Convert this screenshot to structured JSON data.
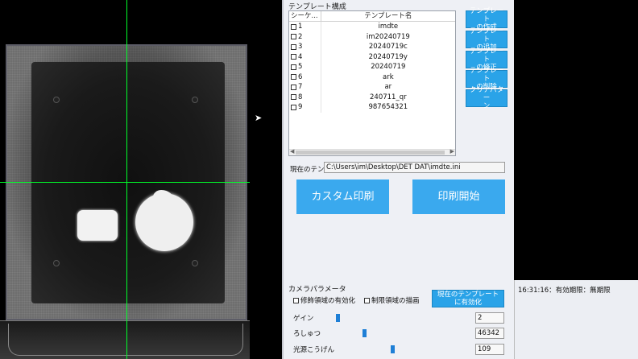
{
  "template_group": {
    "title": "テンプレート構成",
    "columns": [
      "シーケ...",
      "テンプレート名"
    ],
    "rows": [
      {
        "seq": "1",
        "name": "imdte"
      },
      {
        "seq": "2",
        "name": "im20240719"
      },
      {
        "seq": "3",
        "name": "20240719c"
      },
      {
        "seq": "4",
        "name": "20240719y"
      },
      {
        "seq": "5",
        "name": "20240719"
      },
      {
        "seq": "6",
        "name": "ark"
      },
      {
        "seq": "7",
        "name": "ar"
      },
      {
        "seq": "8",
        "name": "240711_qr"
      },
      {
        "seq": "9",
        "name": "987654321"
      }
    ]
  },
  "side_buttons": {
    "create": "テンプレート\nの作成",
    "add": "テンプレート\nの追加",
    "modify": "テンプレート\nの修正",
    "delete": "テンプレート\nの削除",
    "clear": "クリアパター\nン"
  },
  "current_template": {
    "label": "現在のテン",
    "path": "C:\\Users\\im\\Desktop\\DET DAT\\imdte.ini"
  },
  "actions": {
    "custom_print": "カスタム印刷",
    "start_print": "印刷開始"
  },
  "camera_params": {
    "title": "カメラパラメータ",
    "modify_region": "修飾領域の有効化",
    "restrict_region": "制限領域の描画",
    "apply_current": "現在のテンプレート\nに有効化",
    "params": [
      {
        "label": "ゲイン",
        "value": "2",
        "level": 0.02
      },
      {
        "label": "ろしゅつ",
        "value": "46342",
        "level": 0.22
      },
      {
        "label": "光源こうげん",
        "value": "109",
        "level": 0.43
      }
    ]
  },
  "status": {
    "log": "16:31:16：有効期限：無期限"
  },
  "colors": {
    "accent": "#2aa3e8",
    "crosshair": "#00ff2a"
  }
}
